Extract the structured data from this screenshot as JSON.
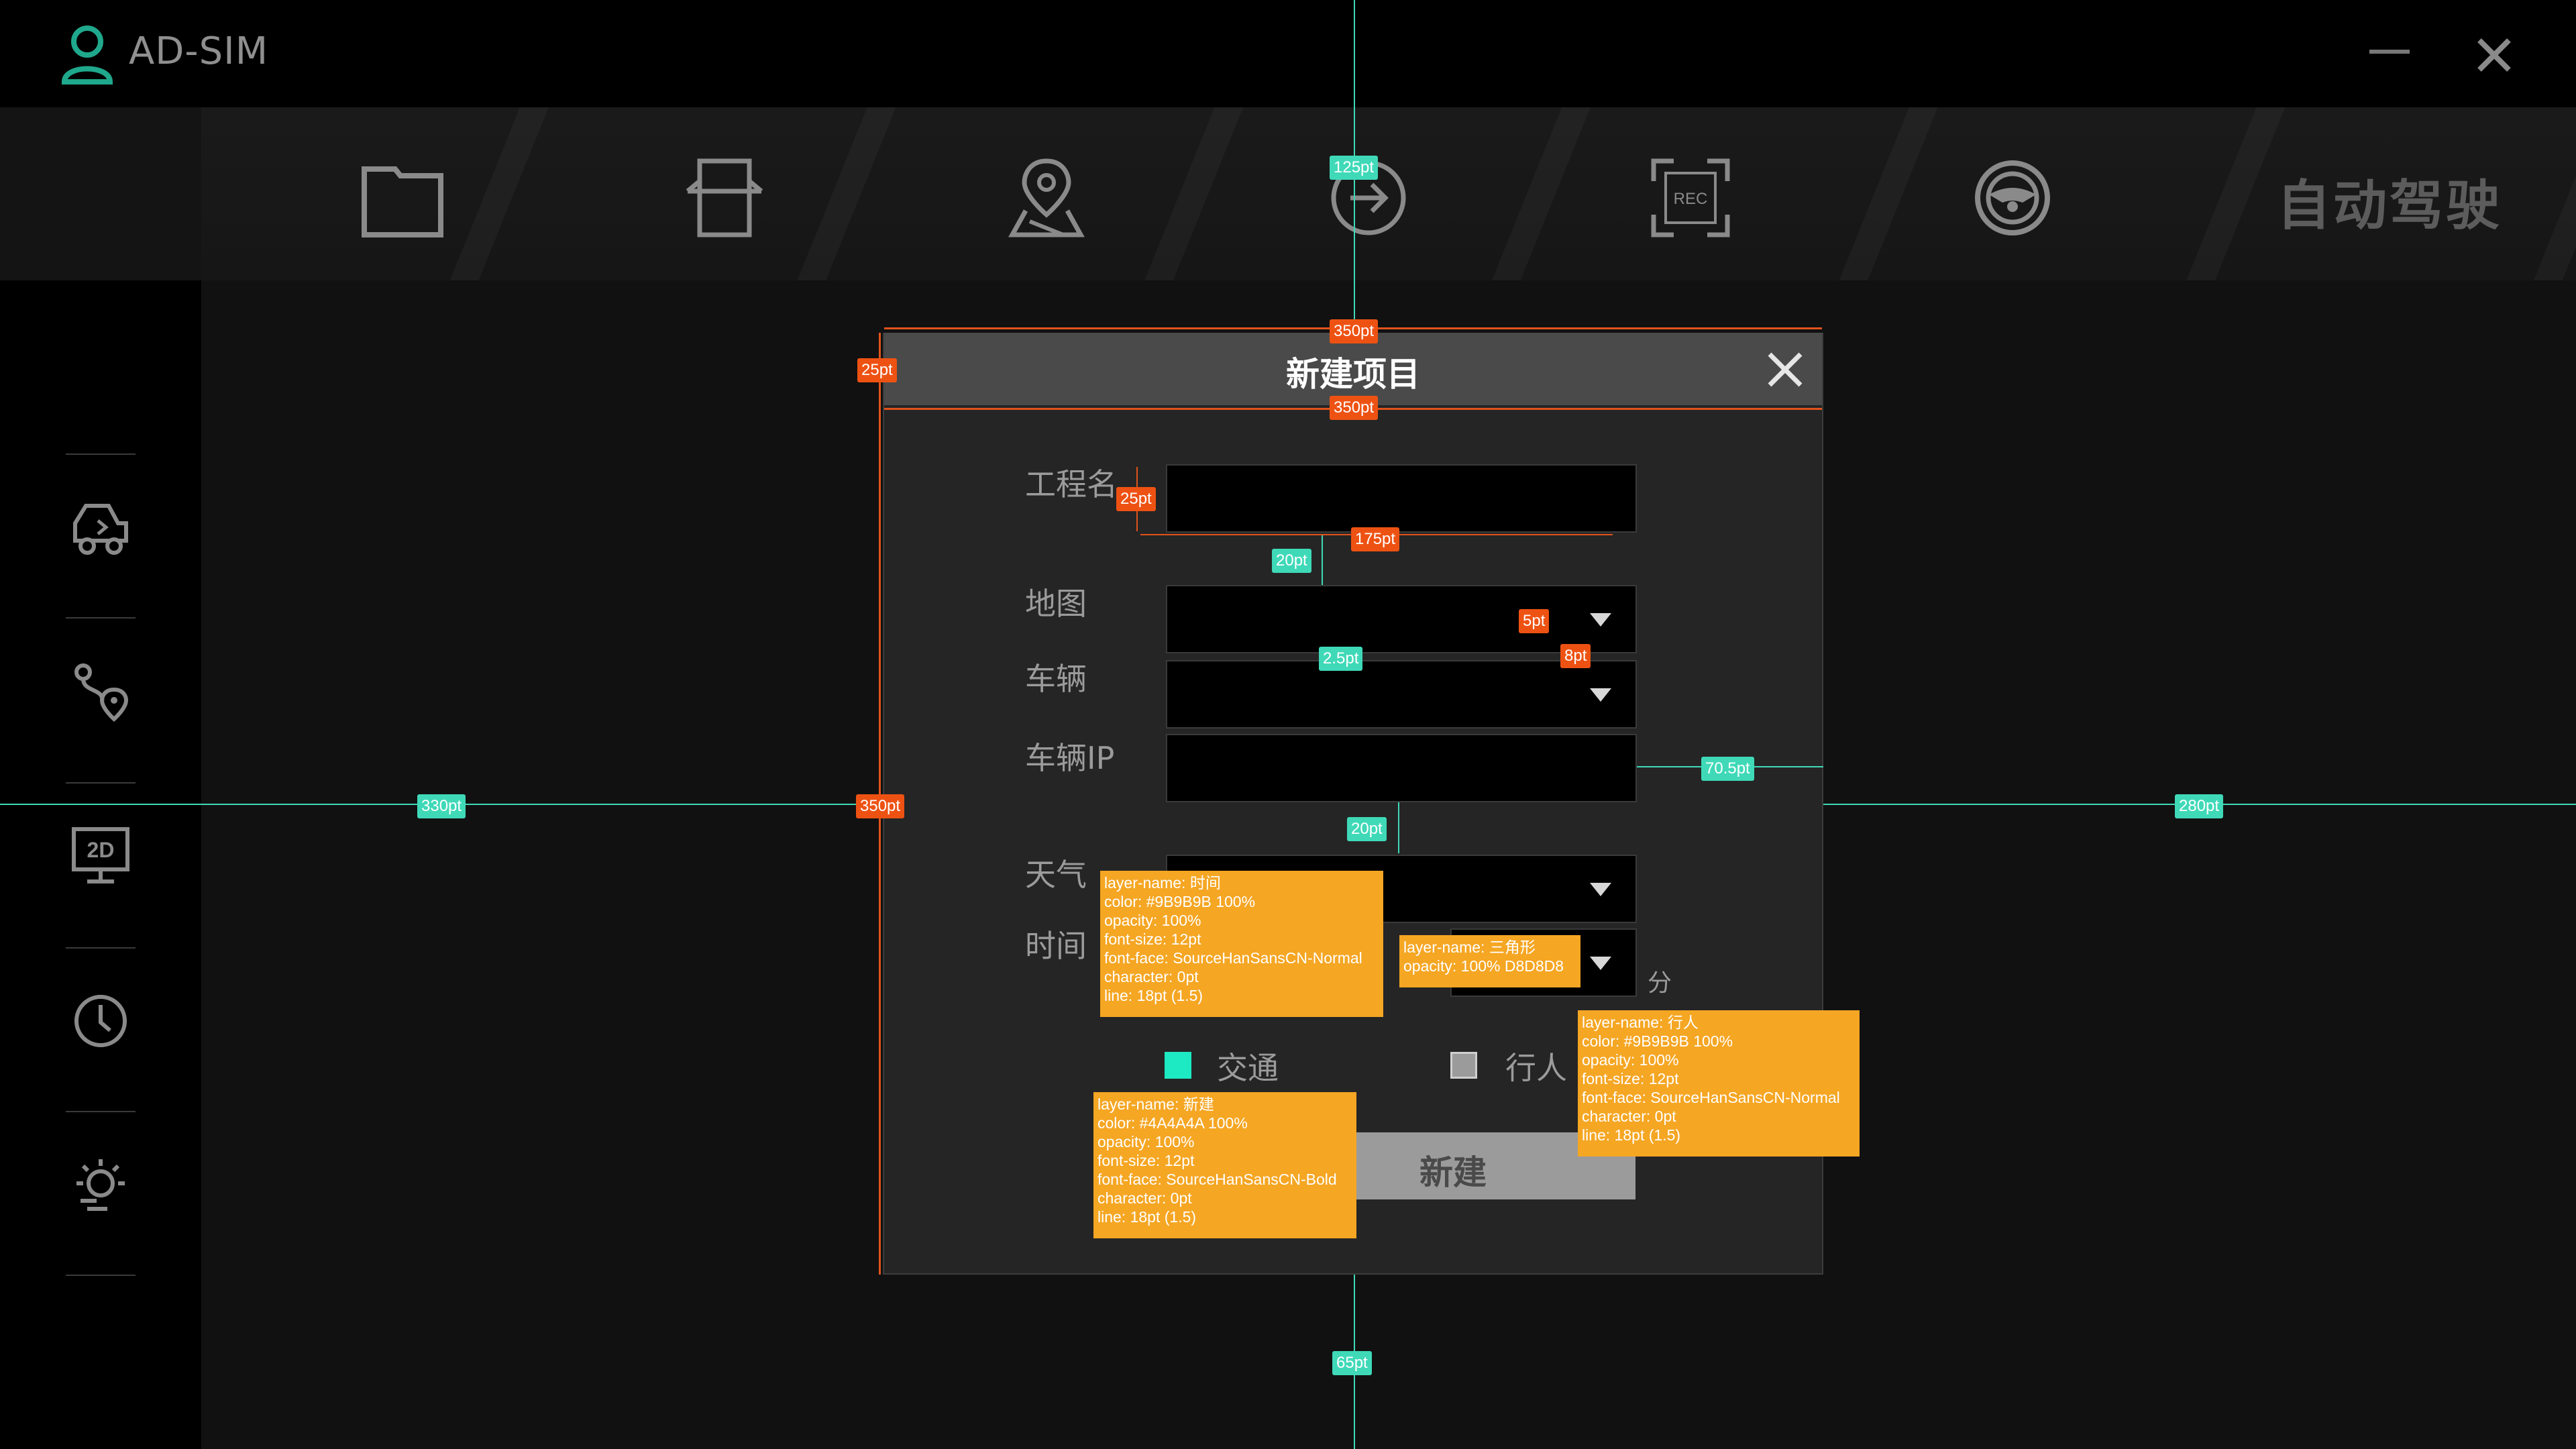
{
  "app": {
    "title": "AD-SIM"
  },
  "toolbar": {
    "icons": [
      "folder-icon",
      "tools-icon",
      "map-pin-icon",
      "arrow-right-circle-icon",
      "rec-icon",
      "steering-wheel-icon"
    ],
    "brand_text": "自动驾驶"
  },
  "sidebar": {
    "icons": [
      "car-icon",
      "route-icon",
      "screen-2d-icon",
      "clock-icon",
      "weather-icon"
    ]
  },
  "dialog": {
    "title": "新建项目",
    "fields": {
      "project_name_label": "工程名",
      "map_label": "地图",
      "vehicle_label": "车辆",
      "vehicle_ip_label": "车辆IP",
      "weather_label": "天气",
      "time_label": "时间",
      "minute_unit": "分"
    },
    "checkboxes": {
      "traffic_label": "交通",
      "traffic_checked": true,
      "pedestrian_label": "行人",
      "pedestrian_checked": false
    },
    "create_button": "新建"
  },
  "measurements": {
    "top_dist": "125pt",
    "dialog_width_top": "350pt",
    "dialog_width_under_header": "350pt",
    "header_height": "25pt",
    "label_height": "25pt",
    "input_width": "175pt",
    "gap_after_name": "20pt",
    "arrow_gap": "5pt",
    "arrow_width": "8pt",
    "field_gap": "2.5pt",
    "right_margin_field": "70.5pt",
    "gap_after_ip": "20pt",
    "left_dist": "330pt",
    "dialog_height": "350pt",
    "right_dist": "280pt",
    "bottom_dist": "65pt"
  },
  "annotations": {
    "time": [
      "layer-name: 时间",
      "color: #9B9B9B 100%",
      "opacity: 100%",
      "font-size: 12pt",
      "font-face: SourceHanSansCN-Normal",
      "character: 0pt",
      "line: 18pt (1.5)"
    ],
    "triangle": [
      "layer-name: 三角形",
      "opacity: 100% D8D8D8"
    ],
    "pedestrian": [
      "layer-name: 行人",
      "color: #9B9B9B 100%",
      "opacity: 100%",
      "font-size: 12pt",
      "font-face: SourceHanSansCN-Normal",
      "character: 0pt",
      "line: 18pt (1.5)"
    ],
    "create": [
      "layer-name: 新建",
      "color: #4A4A4A 100%",
      "opacity: 100%",
      "font-size: 12pt",
      "font-face: SourceHanSansCN-Bold",
      "character: 0pt",
      "line: 18pt (1.5)"
    ]
  },
  "colors": {
    "accent": "#3fd9b8",
    "measure_orange": "#ee5213",
    "annotation_yellow": "#f5a623",
    "checkbox_on": "#1de9c3",
    "checkbox_off": "#9b9b9b"
  }
}
